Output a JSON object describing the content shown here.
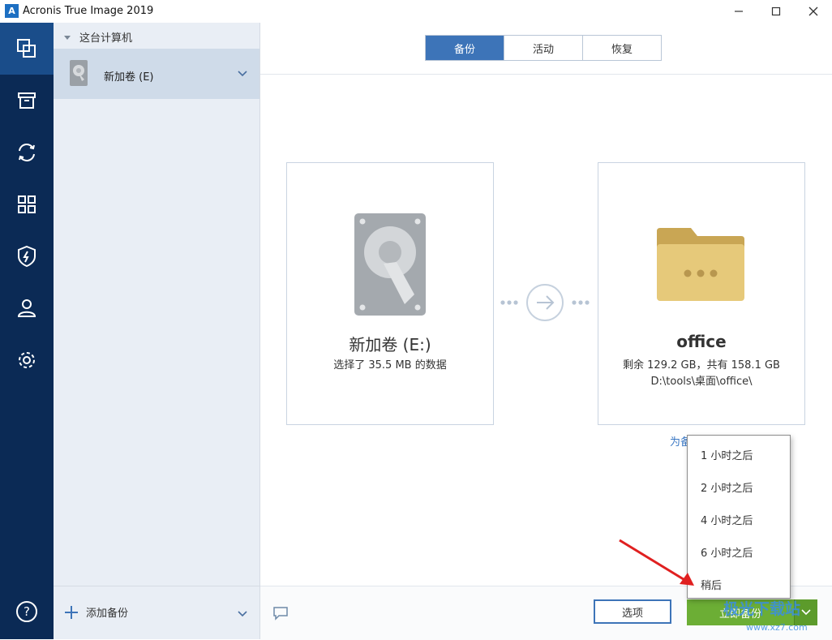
{
  "window": {
    "title": "Acronis True Image 2019",
    "logo_letter": "A"
  },
  "nav": {
    "items": [
      {
        "name": "backup",
        "active": true
      },
      {
        "name": "archive",
        "active": false
      },
      {
        "name": "sync",
        "active": false
      },
      {
        "name": "tools",
        "active": false
      },
      {
        "name": "protection",
        "active": false
      },
      {
        "name": "account",
        "active": false
      },
      {
        "name": "settings",
        "active": false
      },
      {
        "name": "help",
        "active": false
      }
    ]
  },
  "source_panel": {
    "group_label": "这台计算机",
    "selected_item": "新加卷 (E)",
    "add_backup_label": "添加备份"
  },
  "tabs": [
    {
      "label": "备份",
      "active": true
    },
    {
      "label": "活动",
      "active": false
    },
    {
      "label": "恢复",
      "active": false
    }
  ],
  "source_card": {
    "title": "新加卷 (E:)",
    "subtitle": "选择了 35.5 MB 的数据"
  },
  "destination_card": {
    "title": "office",
    "space": "剩余 129.2 GB，共有 158.1 GB",
    "path": "D:\\tools\\桌面\\office\\"
  },
  "schedule_link": "为备",
  "bottom": {
    "options_label": "选项",
    "backup_now_label": "立即备份"
  },
  "dropdown": {
    "items": [
      "1 小时之后",
      "2 小时之后",
      "4 小时之后",
      "6 小时之后",
      "稍后"
    ]
  },
  "watermark": {
    "text": "极光下载站",
    "url": "www.xz7.com"
  },
  "colors": {
    "nav_bg": "#0b2a55",
    "tab_active": "#3d74b8",
    "backup_now": "#6cae35",
    "annotation_arrow": "#e02020"
  }
}
